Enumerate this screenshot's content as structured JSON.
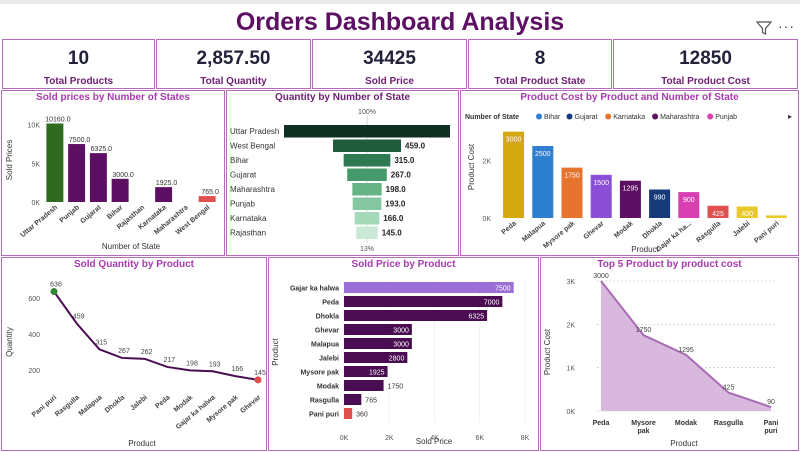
{
  "title": "Orders Dashboard Analysis",
  "kpis": [
    {
      "value": "10",
      "label": "Total Products"
    },
    {
      "value": "2,857.50",
      "label": "Total Quantity"
    },
    {
      "value": "34425",
      "label": "Sold Price"
    },
    {
      "value": "8",
      "label": "Total Product State"
    },
    {
      "value": "12850",
      "label": "Total Product Cost"
    }
  ],
  "colors": {
    "accent": "#5c0f63",
    "panel_title": "#a83aaf",
    "border": "#b46cb8"
  },
  "chart_data": [
    {
      "type": "bar",
      "title": "Sold prices by Number of States",
      "xlabel": "Number of State",
      "ylabel": "Sold Prices",
      "categories": [
        "Uttar Pradesh",
        "Punjab",
        "Gujarat",
        "Bihar",
        "Rajasthan",
        "Karnataka",
        "Maharashtra",
        "West Bengal"
      ],
      "values": [
        10160,
        7500,
        6325,
        3000,
        0,
        1925,
        0,
        765
      ],
      "data_labels": [
        "10160.0",
        "7500.0",
        "6325.0",
        "3000.0",
        "",
        "1925.0",
        "",
        "765.0"
      ],
      "bar_colors": [
        "#2f6b1f",
        "#5c0f63",
        "#5c0f63",
        "#5c0f63",
        "#5c0f63",
        "#5c0f63",
        "#5c0f63",
        "#e0504f"
      ],
      "yticks": [
        "0K",
        "5K",
        "10K"
      ],
      "ylim": [
        0,
        11000
      ]
    },
    {
      "type": "bar",
      "subtype": "funnel",
      "title": "Quantity by Number of State",
      "categories": [
        "Uttar Pradesh",
        "West Bengal",
        "Bihar",
        "Gujarat",
        "Maharashtra",
        "Punjab",
        "Karnataka",
        "Rajasthan"
      ],
      "values": [
        1120,
        459,
        315,
        267,
        198,
        193,
        166,
        145
      ],
      "data_labels": [
        "",
        "459.0",
        "315.0",
        "267.0",
        "198.0",
        "193.0",
        "166.0",
        "145.0"
      ],
      "top_label": "100%",
      "bottom_label": "13%"
    },
    {
      "type": "bar",
      "title": "Product Cost by Product and Number of State",
      "xlabel": "Product",
      "ylabel": "Product Cost",
      "legend_title": "Number of State",
      "legend": [
        {
          "name": "Bihar",
          "color": "#2f7fd0"
        },
        {
          "name": "Gujarat",
          "color": "#173a7a"
        },
        {
          "name": "Karnataka",
          "color": "#e6742e"
        },
        {
          "name": "Maharashtra",
          "color": "#5c0f63"
        },
        {
          "name": "Punjab",
          "color": "#d93fb0"
        }
      ],
      "categories": [
        "Peda",
        "Malapua",
        "Mysore pak",
        "Ghevar",
        "Modak",
        "Dhokla",
        "Gajar ka ha...",
        "Rasgulla",
        "Jalebi",
        "Pani puri"
      ],
      "values": [
        3000,
        2500,
        1750,
        1500,
        1295,
        990,
        900,
        425,
        400,
        90
      ],
      "data_labels": [
        "3000",
        "2500",
        "1750",
        "1500",
        "1295",
        "990",
        "900",
        "425",
        "400",
        ""
      ],
      "bar_colors": [
        "#d4a90f",
        "#2f7fd0",
        "#e6742e",
        "#8a4fd6",
        "#5c0f63",
        "#173a7a",
        "#d93fb0",
        "#e0504f",
        "#e8c82a",
        "#e8c82a"
      ],
      "yticks": [
        "0K",
        "2K"
      ],
      "ylim": [
        0,
        3300
      ]
    },
    {
      "type": "line",
      "title": "Sold Quantity by Product",
      "xlabel": "Product",
      "ylabel": "Quantity",
      "categories": [
        "Pani puri",
        "Rasgulla",
        "Malapua",
        "Dhokla",
        "Jalebi",
        "Peda",
        "Modak",
        "Gajar ka halwa",
        "Mysore pak",
        "Ghevar"
      ],
      "values": [
        636,
        459,
        315,
        267,
        262,
        217,
        198,
        193,
        166,
        145
      ],
      "data_labels": [
        "636",
        "459",
        "315",
        "267",
        "262",
        "217",
        "198",
        "193",
        "166",
        "145"
      ],
      "yticks": [
        "200",
        "400",
        "600"
      ],
      "ylim": [
        100,
        700
      ]
    },
    {
      "type": "bar",
      "orientation": "horizontal",
      "title": "Sold Price by Product",
      "xlabel": "Sold Price",
      "ylabel": "Product",
      "categories": [
        "Gajar ka halwa",
        "Peda",
        "Dhokla",
        "Ghevar",
        "Malapua",
        "Jalebi",
        "Mysore pak",
        "Modak",
        "Rasgulla",
        "Pani puri"
      ],
      "values": [
        7500,
        7000,
        6325,
        3000,
        3000,
        2800,
        1925,
        1750,
        765,
        360
      ],
      "data_labels": [
        "7500",
        "7000",
        "6325",
        "3000",
        "3000",
        "2800",
        "1925",
        "1750",
        "765",
        "360"
      ],
      "bar_colors": [
        "#9b6fd6",
        "#4a0d52",
        "#4a0d52",
        "#4a0d52",
        "#4a0d52",
        "#4a0d52",
        "#4a0d52",
        "#4a0d52",
        "#4a0d52",
        "#e0504f"
      ],
      "xticks": [
        "0K",
        "2K",
        "4K",
        "6K",
        "8K"
      ],
      "xlim": [
        0,
        8000
      ]
    },
    {
      "type": "area",
      "title": "Top 5 Product by product cost",
      "xlabel": "Product",
      "ylabel": "Product Cost",
      "categories": [
        "Peda",
        "Mysore pak",
        "Modak",
        "Rasgulla",
        "Pani puri"
      ],
      "values": [
        3000,
        1750,
        1295,
        425,
        90
      ],
      "data_labels": [
        "3000",
        "1750",
        "1295",
        "425",
        "90"
      ],
      "yticks": [
        "0K",
        "1K",
        "2K",
        "3K"
      ],
      "ylim": [
        0,
        3000
      ]
    }
  ]
}
